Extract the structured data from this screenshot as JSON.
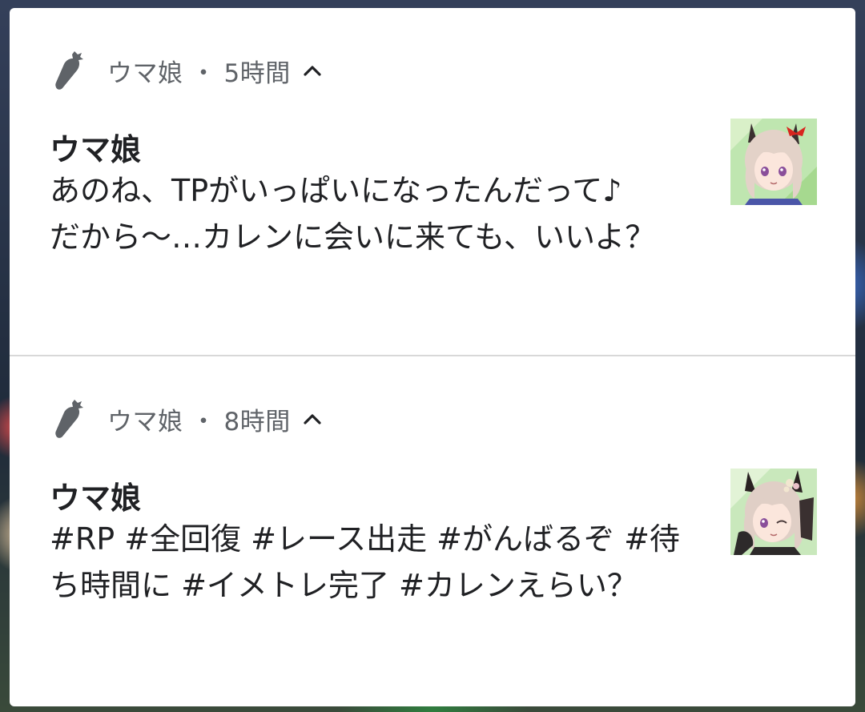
{
  "notifications": [
    {
      "app_name": "ウマ娘",
      "separator": "・",
      "time": "5時間",
      "title": "ウマ娘",
      "body": "あのね、TPがいっぱいになったんだって♪\nだから～…カレンに会いに来ても、いいよ？",
      "icon": "carrot-icon",
      "expand_icon": "chevron-up-icon"
    },
    {
      "app_name": "ウマ娘",
      "separator": "・",
      "time": "8時間",
      "title": "ウマ娘",
      "body": "#RP #全回復 #レース出走 #がんばるぞ #待ち時間に #イメトレ完了 #カレンえらい？",
      "icon": "carrot-icon",
      "expand_icon": "chevron-up-icon"
    }
  ],
  "colors": {
    "panel_bg": "#ffffff",
    "header_text": "#5f6368",
    "body_text": "#202124",
    "divider": "#d8d8d8"
  }
}
